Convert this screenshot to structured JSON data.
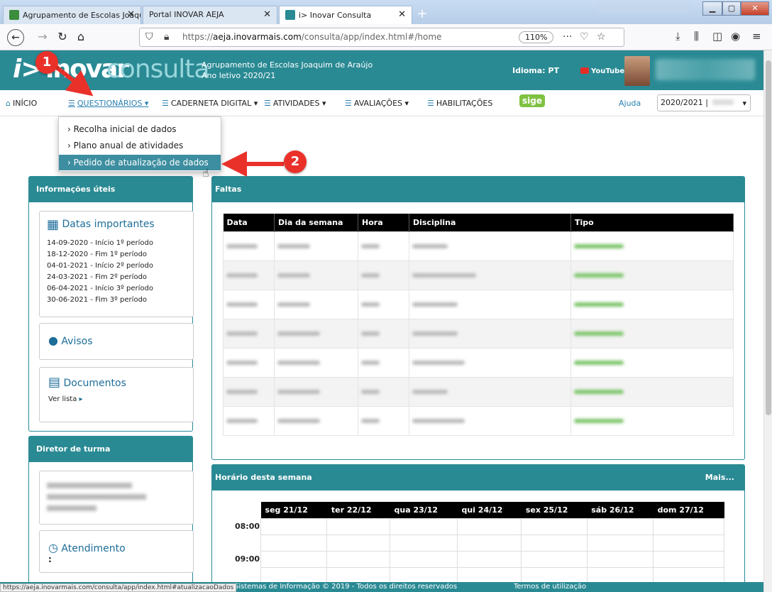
{
  "browser": {
    "tabs": [
      {
        "label": "Agrupamento de Escolas Joaqu",
        "active": false
      },
      {
        "label": "Portal INOVAR AEJA",
        "active": false
      },
      {
        "label": "i> Inovar Consulta",
        "active": true
      }
    ],
    "new_tab_label": "+",
    "url_domain": "aeja.inovarmais.com",
    "url_prefix": "https://",
    "url_path": "/consulta/app/index.html#/home",
    "zoom": "110%",
    "status_url": "https://aeja.inovarmais.com/consulta/app/index.html#atualizacaoDados"
  },
  "header": {
    "logo_i": "i>",
    "logo_inovar": "inovar",
    "logo_consulta": "consulta",
    "school_name": "Agrupamento de Escolas Joaquim de Araújo",
    "school_year": "Ano letivo 2020/21",
    "language": "Idioma: PT",
    "youtube": "YouTube"
  },
  "menu": {
    "inicio": "INÍCIO",
    "questionarios": "QUESTIONÁRIOS",
    "caderneta": "CADERNETA DIGITAL",
    "atividades": "ATIVIDADES",
    "avaliacoes": "AVALIAÇÕES",
    "habilitacoes": "HABILITAÇÕES",
    "sige": "sige",
    "ajuda": "Ajuda",
    "year_select": "2020/2021 |"
  },
  "dropdown": {
    "items": [
      {
        "label": "Recolha inicial de dados"
      },
      {
        "label": "Plano anual de atividades"
      },
      {
        "label": "Pedido de atualização de dados"
      }
    ]
  },
  "annotations": {
    "badge1": "1",
    "badge2": "2"
  },
  "info": {
    "title": "Informações úteis",
    "datas_title": "Datas importantes",
    "dates": [
      "14-09-2020 - Início 1º período",
      "18-12-2020 - Fim 1º período",
      "04-01-2021 - Início 2º período",
      "24-03-2021 - Fim 2º período",
      "06-04-2021 - Início 3º período",
      "30-06-2021 - Fim 3º período"
    ],
    "avisos": "Avisos",
    "documentos": "Documentos",
    "ver_lista": "Ver lista"
  },
  "diretor": {
    "title": "Diretor de turma",
    "atendimento": "Atendimento",
    "atendimento_value": ":"
  },
  "faltas": {
    "title": "Faltas",
    "columns": [
      "Data",
      "Dia da semana",
      "Hora",
      "Disciplina",
      "Tipo"
    ]
  },
  "horario": {
    "title": "Horário desta semana",
    "more": "Mais...",
    "days": [
      "seg 21/12",
      "ter 22/12",
      "qua 23/12",
      "qui 24/12",
      "sex 25/12",
      "sáb 26/12",
      "dom 27/12"
    ],
    "hours": [
      "08:00",
      "09:00"
    ]
  },
  "footer": {
    "copyright": "Sistemas de Informação © 2019 - Todos os direitos reservados",
    "terms": "Termos de utilização"
  },
  "colors": {
    "teal": "#2a8a94",
    "badge_red": "#e9312a",
    "sige_green": "#7fc242"
  }
}
